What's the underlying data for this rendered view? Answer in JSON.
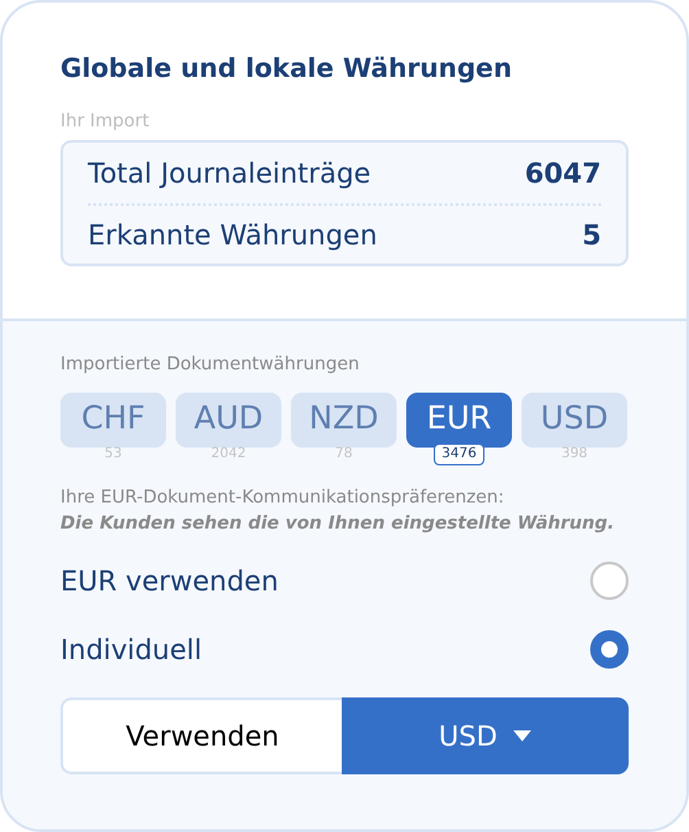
{
  "title": "Globale und lokale Währungen",
  "import_label": "Ihr Import",
  "stats": [
    {
      "label": "Total Journaleinträge",
      "value": "6047"
    },
    {
      "label": "Erkannte Währungen",
      "value": "5"
    }
  ],
  "currencies_label": "Importierte Dokumentwährungen",
  "currencies": [
    {
      "code": "CHF",
      "count": "53",
      "selected": false
    },
    {
      "code": "AUD",
      "count": "2042",
      "selected": false
    },
    {
      "code": "NZD",
      "count": "78",
      "selected": false
    },
    {
      "code": "EUR",
      "count": "3476",
      "selected": true
    },
    {
      "code": "USD",
      "count": "398",
      "selected": false
    }
  ],
  "preference_label": "Ihre EUR-Dokument-Kommunikationspräferenzen:",
  "preference_note": "Die Kunden sehen die von Ihnen eingestellte Währung.",
  "options": [
    {
      "label": "EUR verwenden",
      "selected": false
    },
    {
      "label": "Individuell",
      "selected": true
    }
  ],
  "use_button": "Verwenden",
  "currency_dropdown": {
    "value": "USD"
  }
}
